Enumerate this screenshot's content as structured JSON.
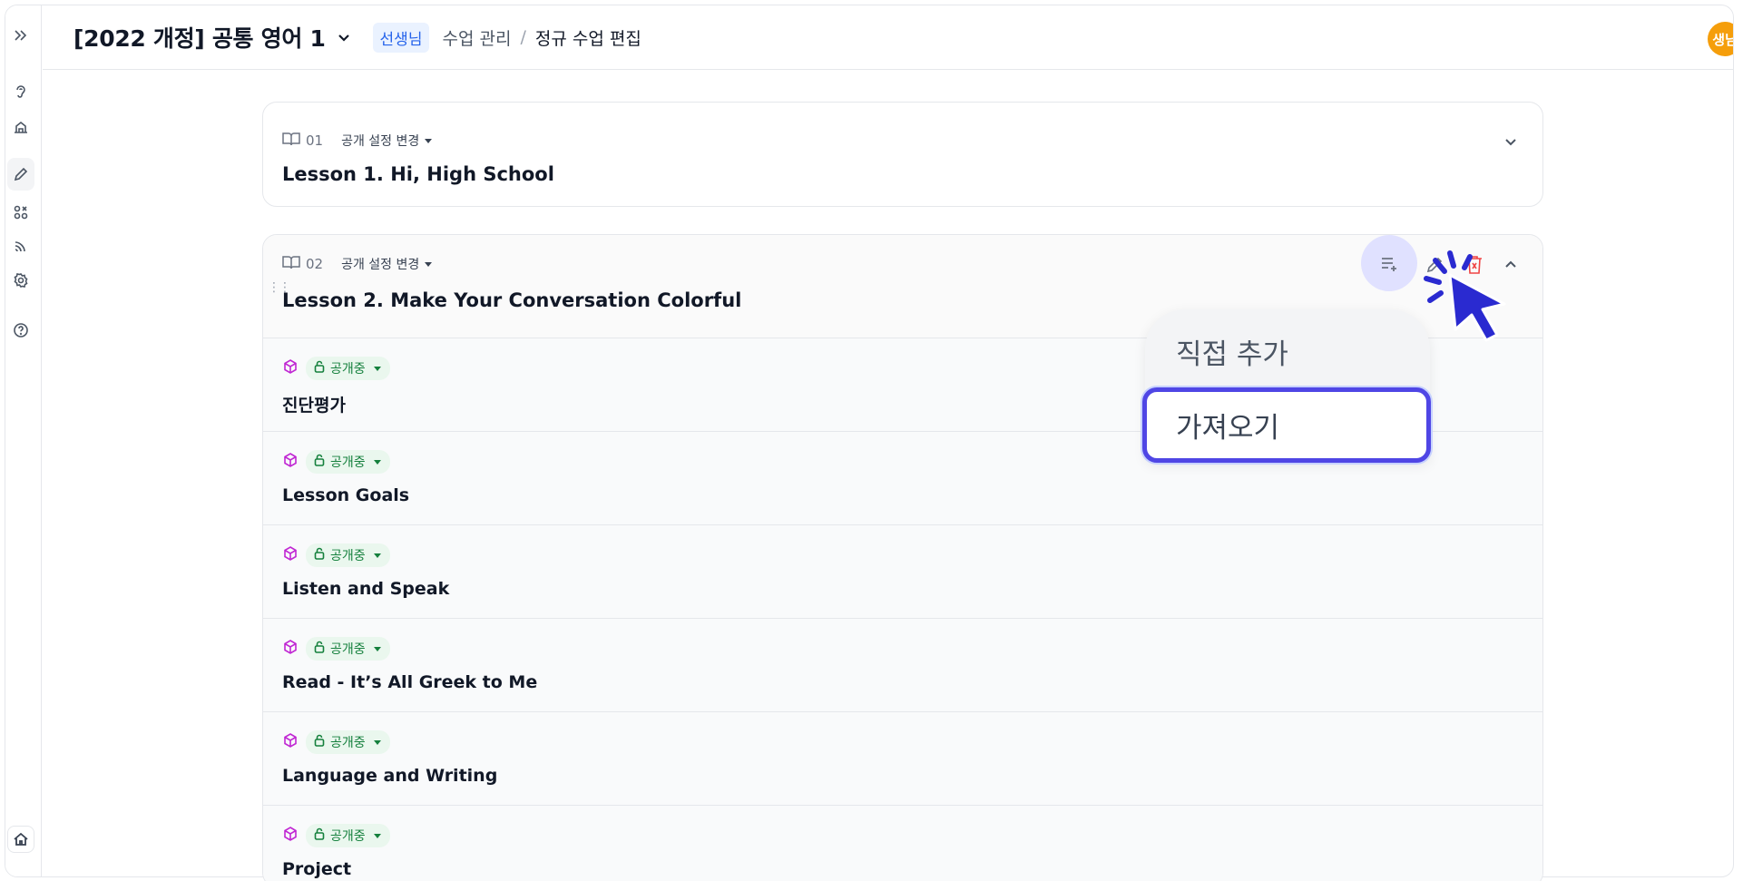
{
  "header": {
    "course_title": "[2022 개정] 공통 영어 1",
    "role_badge": "선생님",
    "breadcrumb_parent": "수업 관리",
    "breadcrumb_separator": "/",
    "breadcrumb_current": "정규 수업 편집",
    "avatar_text": "생님"
  },
  "lessons": [
    {
      "number": "01",
      "visibility_label": "공개 설정 변경",
      "title": "Lesson 1. Hi, High School",
      "expanded": false
    },
    {
      "number": "02",
      "visibility_label": "공개 설정 변경",
      "title": "Lesson 2. Make Your Conversation Colorful",
      "expanded": true,
      "items": [
        {
          "status": "공개중",
          "title": "진단평가"
        },
        {
          "status": "공개중",
          "title": "Lesson Goals"
        },
        {
          "status": "공개중",
          "title": "Listen and Speak"
        },
        {
          "status": "공개중",
          "title": "Read - It’s All Greek to Me"
        },
        {
          "status": "공개중",
          "title": "Language and Writing"
        },
        {
          "status": "공개중",
          "title": "Project"
        }
      ]
    }
  ],
  "add_menu": {
    "direct_add": "직접 추가",
    "import": "가져오기"
  },
  "colors": {
    "accent": "#4f46e5",
    "badge_blue": "#2563eb",
    "status_green": "#15803d",
    "delete_red": "#ef4444",
    "avatar_orange": "#f59e0b"
  }
}
